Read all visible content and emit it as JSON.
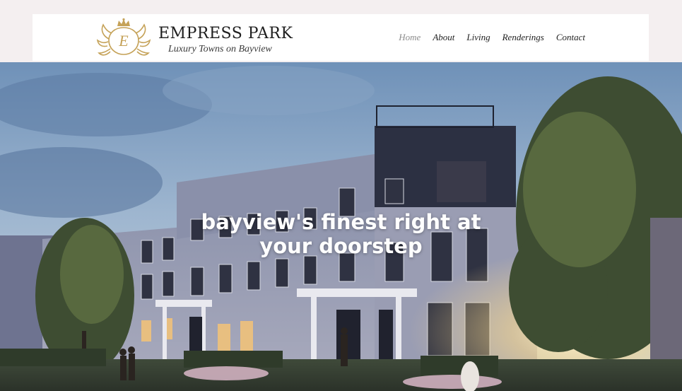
{
  "brand": {
    "title": "EMPRESS PARK",
    "tagline": "Luxury Towns on Bayview",
    "crest_letter": "E",
    "gold": "#c5a258"
  },
  "nav": {
    "items": [
      {
        "label": "Home",
        "active": true
      },
      {
        "label": "About"
      },
      {
        "label": "Living"
      },
      {
        "label": "Renderings"
      },
      {
        "label": "Contact"
      }
    ]
  },
  "hero": {
    "headline_line1": "bayview's finest right at",
    "headline_line2": "your doorstep",
    "image": "townhouse-rendering"
  }
}
